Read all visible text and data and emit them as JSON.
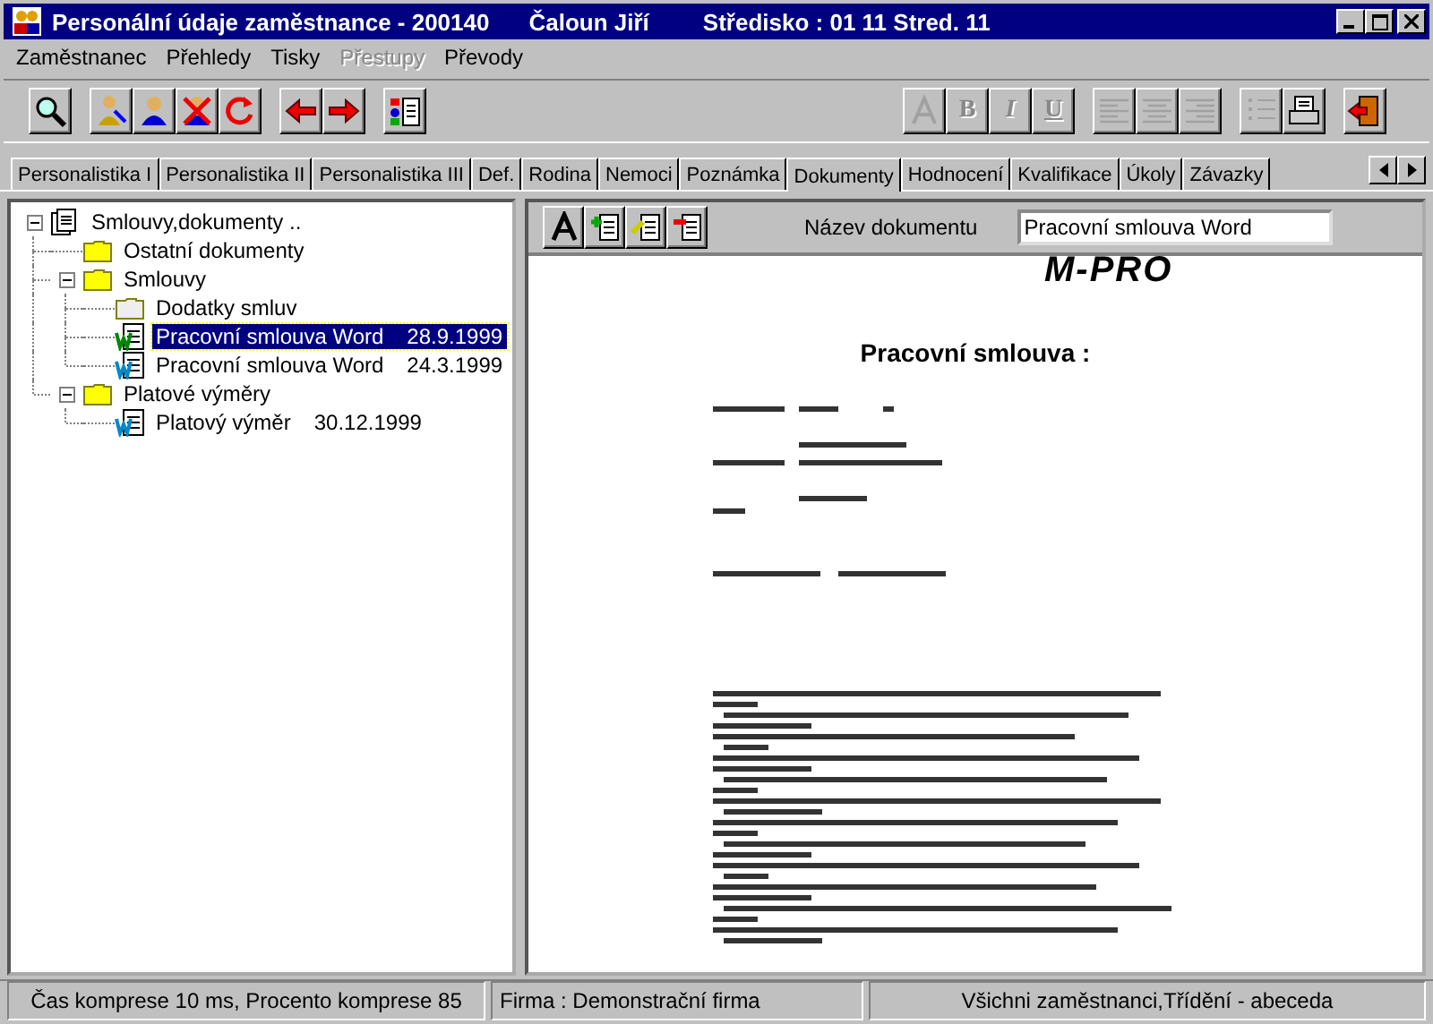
{
  "window": {
    "title": "Personální údaje zaměstnance - 200140",
    "employee": "Čaloun Jiří",
    "center": "Středisko : 01  11 Stred. 11"
  },
  "menu": [
    {
      "label": "Zaměstnanec",
      "disabled": false
    },
    {
      "label": "Přehledy",
      "disabled": false
    },
    {
      "label": "Tisky",
      "disabled": false
    },
    {
      "label": "Přestupy",
      "disabled": true
    },
    {
      "label": "Převody",
      "disabled": false
    }
  ],
  "toolbar": [
    [
      {
        "kind": "search",
        "disabled": false
      }
    ],
    [
      {
        "kind": "person-edit",
        "disabled": false
      },
      {
        "kind": "person",
        "disabled": false
      },
      {
        "kind": "person-delete",
        "disabled": false
      },
      {
        "kind": "refresh",
        "disabled": false
      }
    ],
    [
      {
        "kind": "arrow-left",
        "disabled": false
      },
      {
        "kind": "arrow-right",
        "disabled": false
      }
    ],
    [
      {
        "kind": "report",
        "disabled": false
      }
    ],
    [
      {
        "kind": "spacer"
      }
    ],
    [
      {
        "kind": "font",
        "disabled": true
      },
      {
        "kind": "text",
        "label": "B",
        "disabled": true
      },
      {
        "kind": "text",
        "label": "I",
        "disabled": true
      },
      {
        "kind": "text",
        "label": "U",
        "disabled": true
      }
    ],
    [
      {
        "kind": "align-left",
        "disabled": true
      },
      {
        "kind": "align-center",
        "disabled": true
      },
      {
        "kind": "align-right",
        "disabled": true
      }
    ],
    [
      {
        "kind": "list",
        "disabled": true
      },
      {
        "kind": "print",
        "disabled": false
      }
    ],
    [
      {
        "kind": "exit",
        "disabled": false
      }
    ]
  ],
  "tabs": [
    {
      "label": "Personalistika I",
      "selected": false
    },
    {
      "label": "Personalistika II",
      "selected": false
    },
    {
      "label": "Personalistika III",
      "selected": false
    },
    {
      "label": "Def.",
      "selected": false
    },
    {
      "label": "Rodina",
      "selected": false
    },
    {
      "label": "Nemoci",
      "selected": false
    },
    {
      "label": "Poznámka",
      "selected": false
    },
    {
      "label": "Dokumenty",
      "selected": true
    },
    {
      "label": "Hodnocení",
      "selected": false
    },
    {
      "label": "Kvalifikace",
      "selected": false
    },
    {
      "label": "Úkoly",
      "selected": false
    },
    {
      "label": "Závazky",
      "selected": false
    }
  ],
  "tree": {
    "label": "Smlouvy,dokumenty ..",
    "kind": "documents",
    "expanded": true,
    "selected": false,
    "children": [
      {
        "label": "Ostatní dokumenty",
        "kind": "folder",
        "selected": false
      },
      {
        "label": "Smlouvy",
        "kind": "folder",
        "expanded": true,
        "selected": false,
        "children": [
          {
            "label": "Dodatky smluv",
            "kind": "folder-empty",
            "selected": false
          },
          {
            "label": "Pracovní smlouva Word",
            "date": "28.9.1999",
            "kind": "word",
            "selected": true
          },
          {
            "label": "Pracovní smlouva Word",
            "date": "24.3.1999",
            "kind": "word",
            "selected": false
          }
        ]
      },
      {
        "label": "Platové výměry",
        "kind": "folder",
        "expanded": true,
        "selected": false,
        "children": [
          {
            "label": "Platový výměr",
            "date": "30.12.1999",
            "kind": "word",
            "selected": false
          }
        ]
      }
    ]
  },
  "document_panel": {
    "tools": [
      {
        "kind": "font"
      },
      {
        "kind": "add"
      },
      {
        "kind": "edit"
      },
      {
        "kind": "remove"
      }
    ],
    "name_label": "Název dokumentu",
    "name_value": "Pracovní smlouva Word",
    "logo": "M-PRO",
    "heading": "Pracovní smlouva :"
  },
  "status_bar": [
    "Čas komprese 10  ms, Procento komprese 85",
    "Firma :  Demonstrační firma",
    "Všichni zaměstnanci,Třídění - abeceda"
  ]
}
